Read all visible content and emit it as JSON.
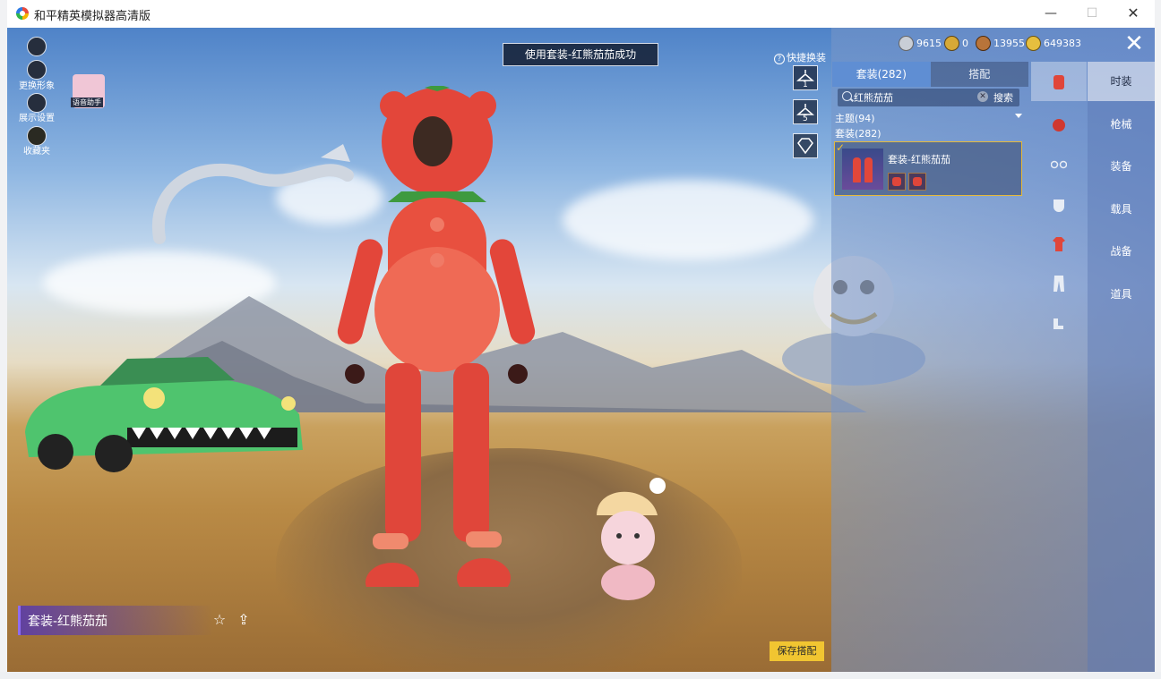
{
  "window": {
    "title": "和平精英模拟器高清版",
    "min_glyph": "—",
    "max_glyph": "☐",
    "close_glyph": "✕"
  },
  "currencies": [
    {
      "icon": "silver-coin-icon",
      "value": "9615",
      "color": "#c9ced6"
    },
    {
      "icon": "gold-token-icon",
      "value": "0",
      "color": "#d7a936"
    },
    {
      "icon": "bronze-coin-icon",
      "value": "13955",
      "color": "#b8743a"
    },
    {
      "icon": "gold-coin-icon",
      "value": "649383",
      "color": "#e6bf3f"
    }
  ],
  "banner": "使用套装-红熊茄茄成功",
  "left_menu": [
    {
      "icon": "play-icon",
      "label": ""
    },
    {
      "icon": "avatar-icon",
      "label": "更换形象"
    },
    {
      "icon": "eye-icon",
      "label": "展示设置"
    },
    {
      "icon": "collection-icon",
      "label": "收藏夹"
    }
  ],
  "voice_assistant": "语音助手",
  "quick_change_label": "快捷换装",
  "panel": {
    "tabs": [
      {
        "label": "套装(282)",
        "active": true
      },
      {
        "label": "搭配",
        "active": false
      }
    ],
    "search": {
      "value": "红熊茄茄",
      "clear_glyph": "✕",
      "button": "搜索"
    },
    "filter_theme": "主题(94)",
    "filter_suits": "套装(282)",
    "result_item": {
      "name": "套装-红熊茄茄",
      "check_glyph": "✓"
    }
  },
  "categories": [
    {
      "icon": "outfit-icon",
      "label": "时装",
      "active": true
    },
    {
      "icon": "weapon-icon",
      "label": "枪械",
      "active": false
    },
    {
      "icon": "equipment-icon",
      "label": "装备",
      "active": false
    },
    {
      "icon": "vehicle-icon",
      "label": "载具",
      "active": false
    },
    {
      "icon": "battle-gear-icon",
      "label": "战备",
      "active": false
    },
    {
      "icon": "item-icon",
      "label": "道具",
      "active": false
    }
  ],
  "close_glyph": "✕",
  "bottom": {
    "outfit_name": "套装-红熊茄茄",
    "save_button": "保存搭配",
    "favorite_glyph": "☆",
    "share_glyph": "⇪"
  },
  "colors": {
    "accent_gold": "#f1c531",
    "tab_active": "#5f8ed3",
    "outfit_red": "#e0463a"
  }
}
